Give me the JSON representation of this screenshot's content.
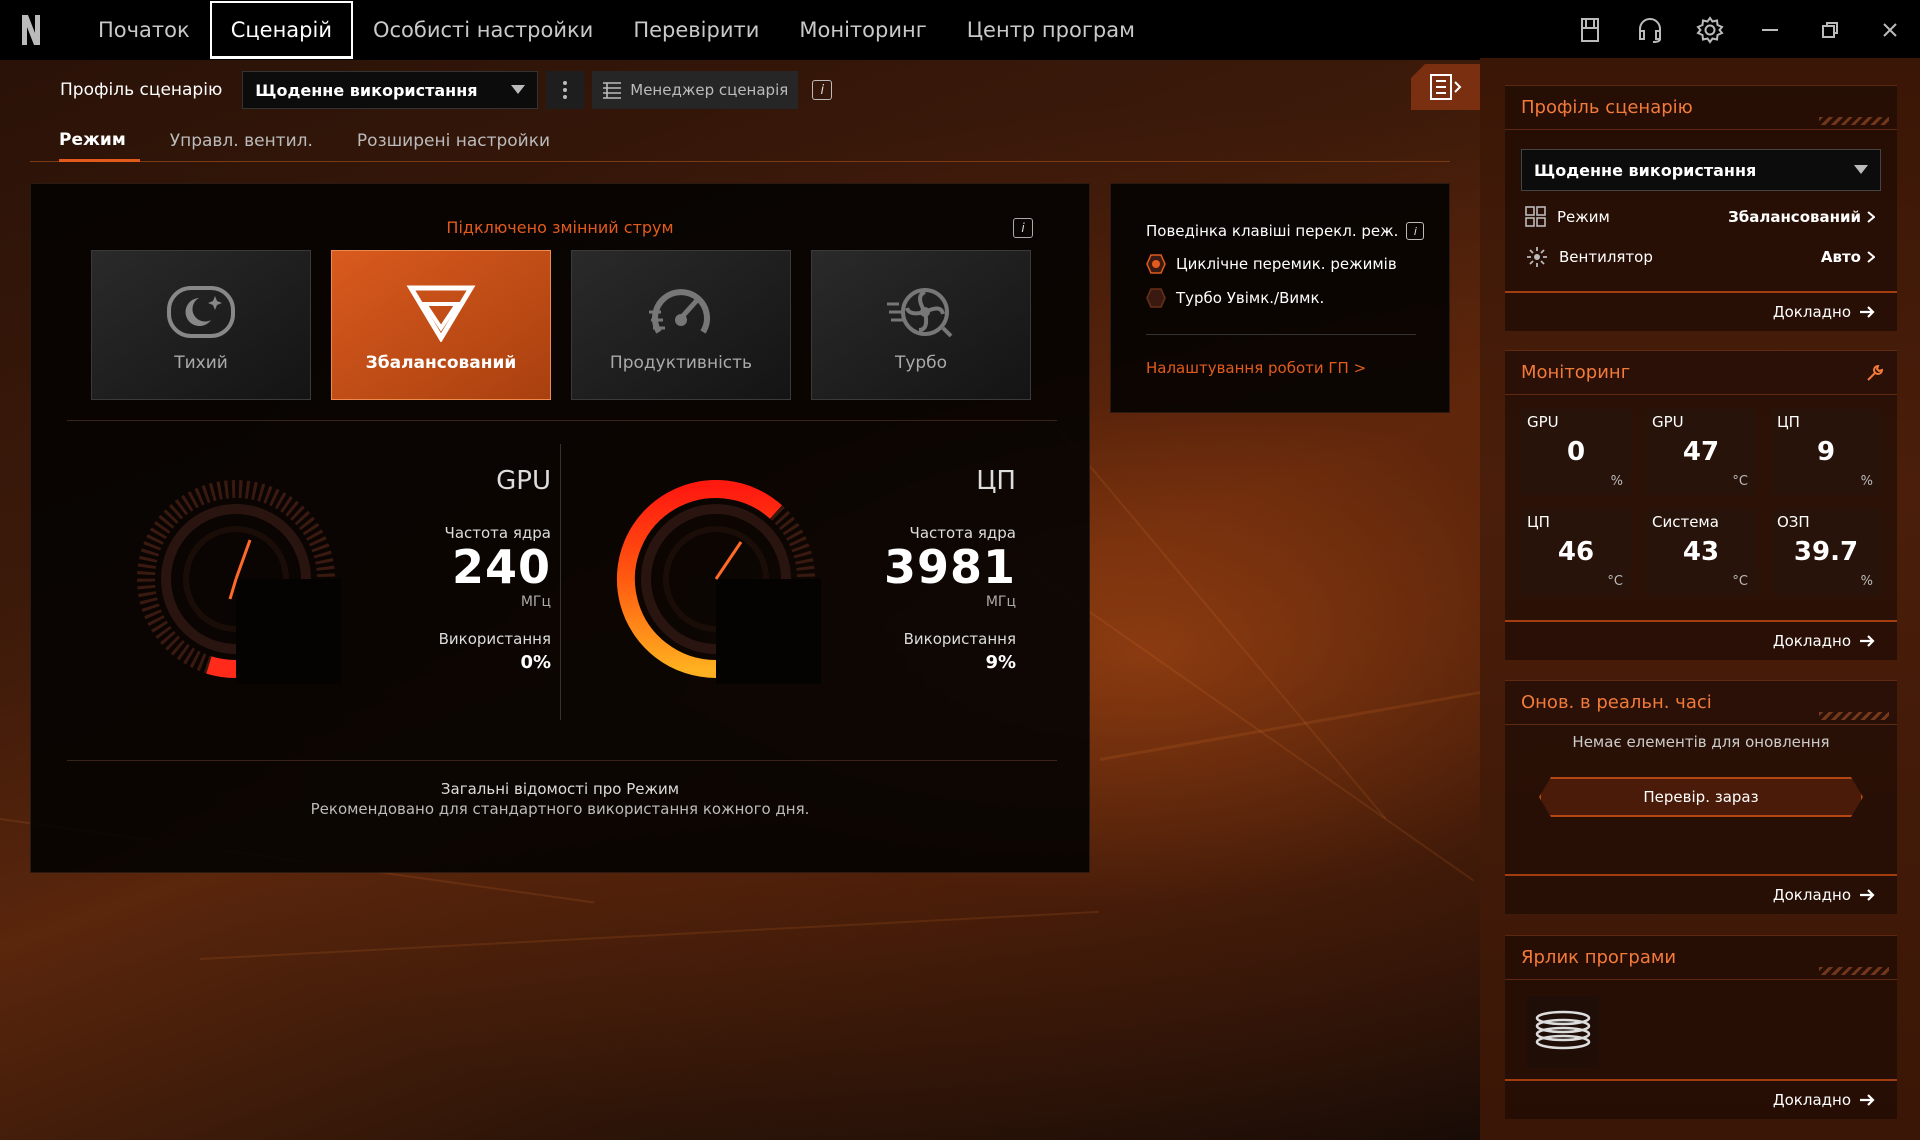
{
  "nav": {
    "items": [
      "Початок",
      "Сценарій",
      "Особисті настройки",
      "Перевірити",
      "Моніторинг",
      "Центр програм"
    ],
    "active_index": 1
  },
  "profile": {
    "label": "Профіль сценарію",
    "selected": "Щоденне використання",
    "manager_label": "Менеджер сценарія"
  },
  "subtabs": [
    "Режим",
    "Управл. вентил.",
    "Розширені настройки"
  ],
  "main": {
    "power_status": "Підключено змінний струм",
    "modes": [
      {
        "label": "Тихий",
        "icon": "moon-icon"
      },
      {
        "label": "Збалансований",
        "icon": "balanced-icon"
      },
      {
        "label": "Продуктивність",
        "icon": "speedometer-icon"
      },
      {
        "label": "Турбо",
        "icon": "turbo-fan-icon"
      }
    ],
    "active_mode_index": 1,
    "gpu": {
      "title": "GPU",
      "freq_label": "Частота ядра",
      "freq_value": "240",
      "freq_unit": "МГц",
      "usage_label": "Використання",
      "usage_value": "0%"
    },
    "cpu": {
      "title": "ЦП",
      "freq_label": "Частота ядра",
      "freq_value": "3981",
      "freq_unit": "МГц",
      "usage_label": "Використання",
      "usage_value": "9%"
    },
    "overview_title": "Загальні відомості про Режим",
    "overview_desc": "Рекомендовано для стандартного використання кожного дня."
  },
  "key_behavior": {
    "title": "Поведінка клавіші перекл. реж.",
    "options": [
      "Циклічне перемик. режимів",
      "Турбо Увімк./Вимк."
    ],
    "selected_index": 0,
    "gpu_link": "Налаштування роботи ГП >"
  },
  "sidebar": {
    "profile": {
      "title": "Профіль сценарію",
      "selected": "Щоденне використання",
      "mode_label": "Режим",
      "mode_value": "Збалансований",
      "fan_label": "Вентилятор",
      "fan_value": "Авто",
      "more": "Докладно"
    },
    "monitoring": {
      "title": "Моніторинг",
      "cells": [
        {
          "name": "GPU",
          "value": "0",
          "unit": "%"
        },
        {
          "name": "GPU",
          "value": "47",
          "unit": "°C"
        },
        {
          "name": "ЦП",
          "value": "9",
          "unit": "%"
        },
        {
          "name": "ЦП",
          "value": "46",
          "unit": "°C"
        },
        {
          "name": "Система",
          "value": "43",
          "unit": "°C"
        },
        {
          "name": "ОЗП",
          "value": "39.7",
          "unit": "%"
        }
      ],
      "more": "Докладно"
    },
    "realtime": {
      "title": "Онов. в реальн. часі",
      "empty": "Немає елементів для оновлення",
      "button": "Перевір. зараз",
      "more": "Докладно"
    },
    "shortcut": {
      "title": "Ярлик програми",
      "more": "Докладно"
    }
  },
  "colors": {
    "accent": "#e25b1d",
    "accent_light": "#f27a3b",
    "active_mode": "#d95a1e"
  }
}
